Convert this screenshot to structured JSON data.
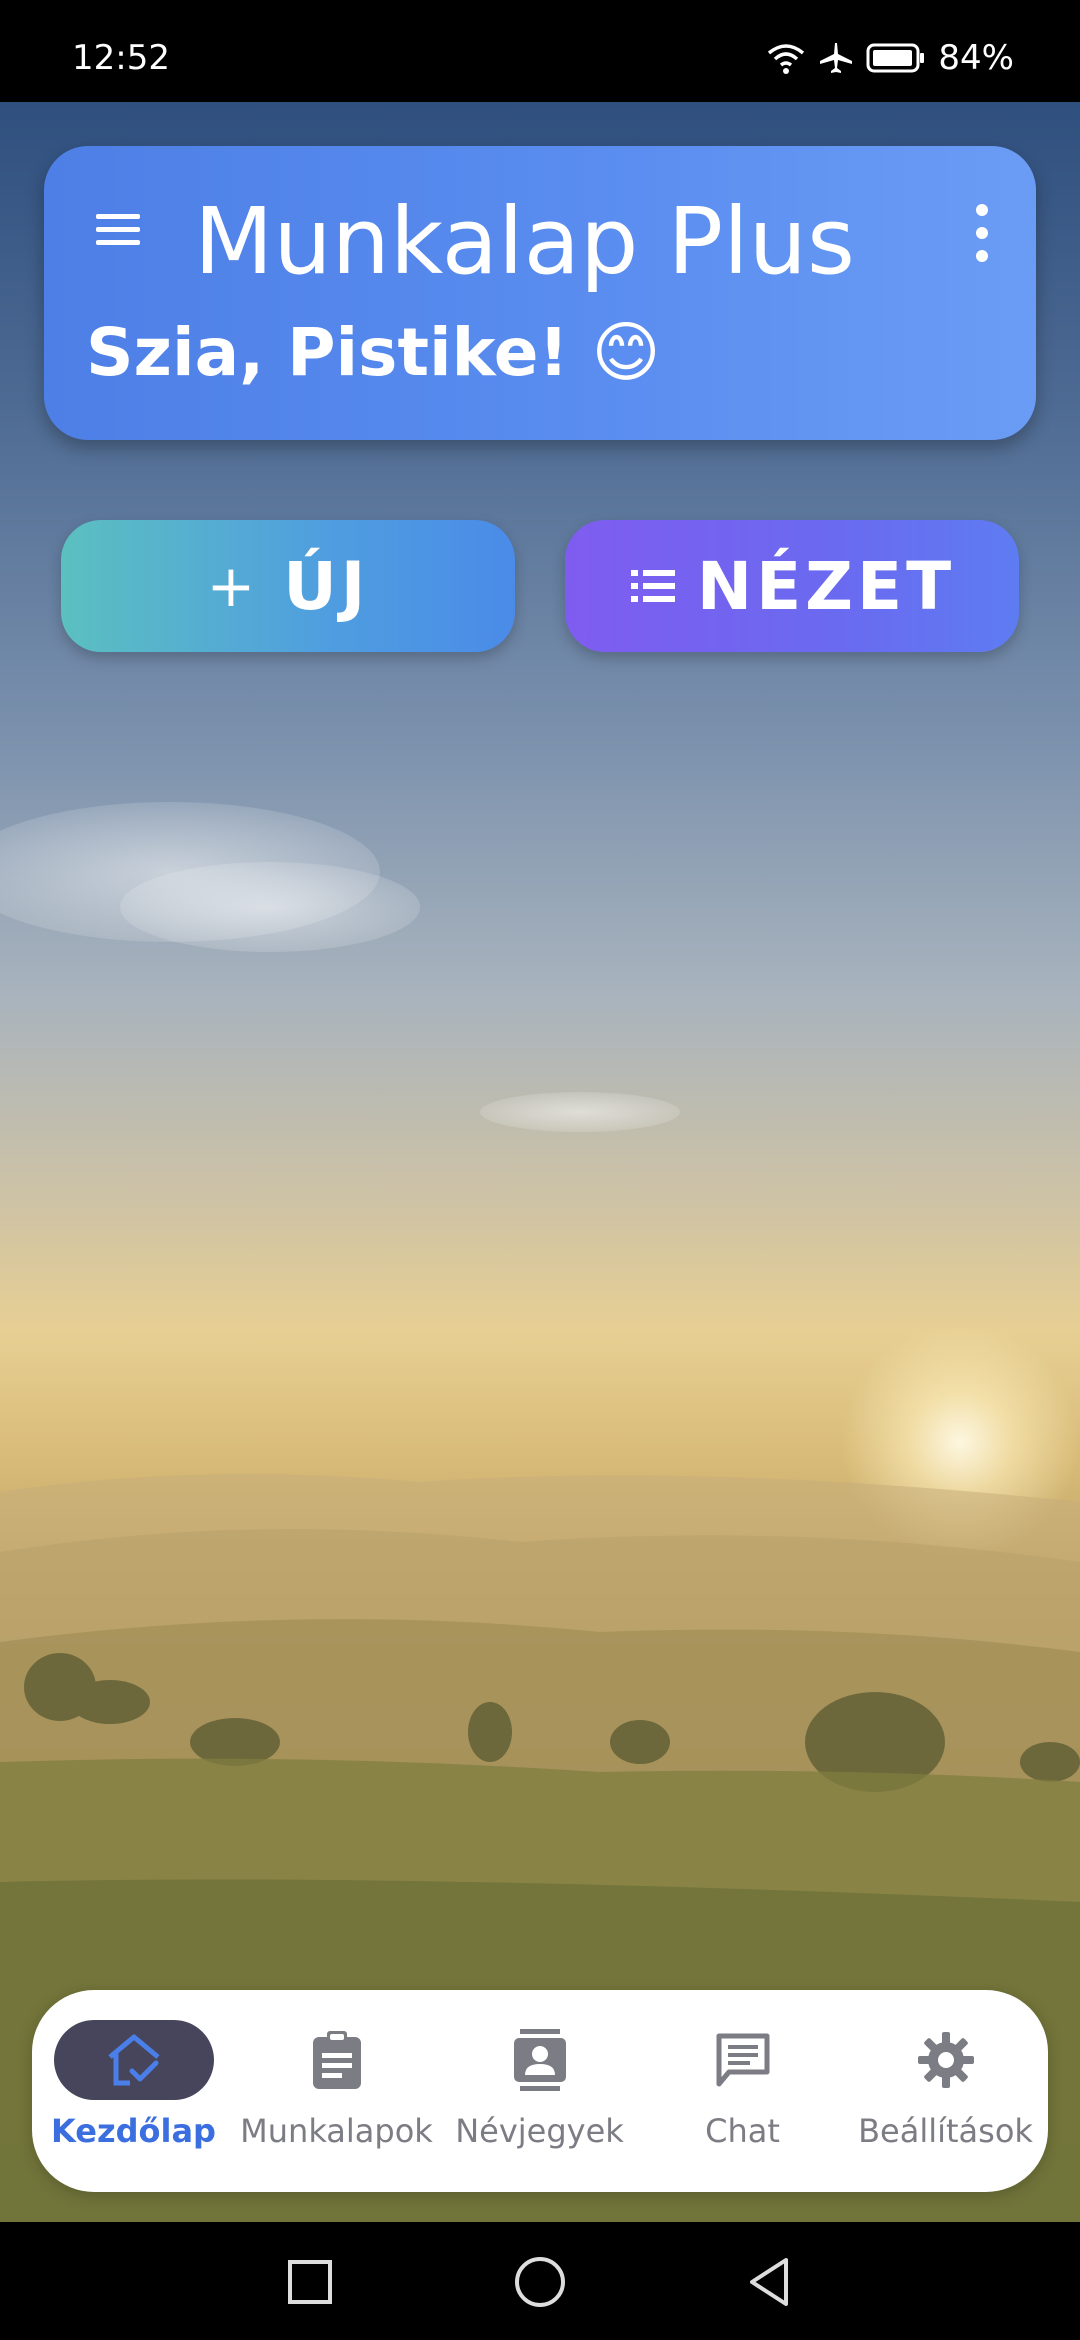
{
  "status_bar": {
    "time": "12:52",
    "battery": "84%",
    "icons": [
      "wifi-icon",
      "airplane-icon",
      "battery-icon"
    ]
  },
  "header": {
    "title": "Munkalap Plus",
    "greeting": "Szia, Pistike! 😊"
  },
  "actions": {
    "new_label": "ÚJ",
    "new_icon": "+",
    "view_label": "NÉZET"
  },
  "bottom_nav": [
    {
      "label": "Kezdőlap",
      "icon": "home-check-icon",
      "active": true
    },
    {
      "label": "Munkalapok",
      "icon": "clipboard-icon",
      "active": false
    },
    {
      "label": "Névjegyek",
      "icon": "contacts-icon",
      "active": false
    },
    {
      "label": "Chat",
      "icon": "chat-icon",
      "active": false
    },
    {
      "label": "Beállítások",
      "icon": "gear-icon",
      "active": false
    }
  ],
  "colors": {
    "header": "#5b8ef0",
    "accent": "#3b6fe0",
    "view_button": "#7f5cf0",
    "new_button": "#5bc0c0"
  }
}
